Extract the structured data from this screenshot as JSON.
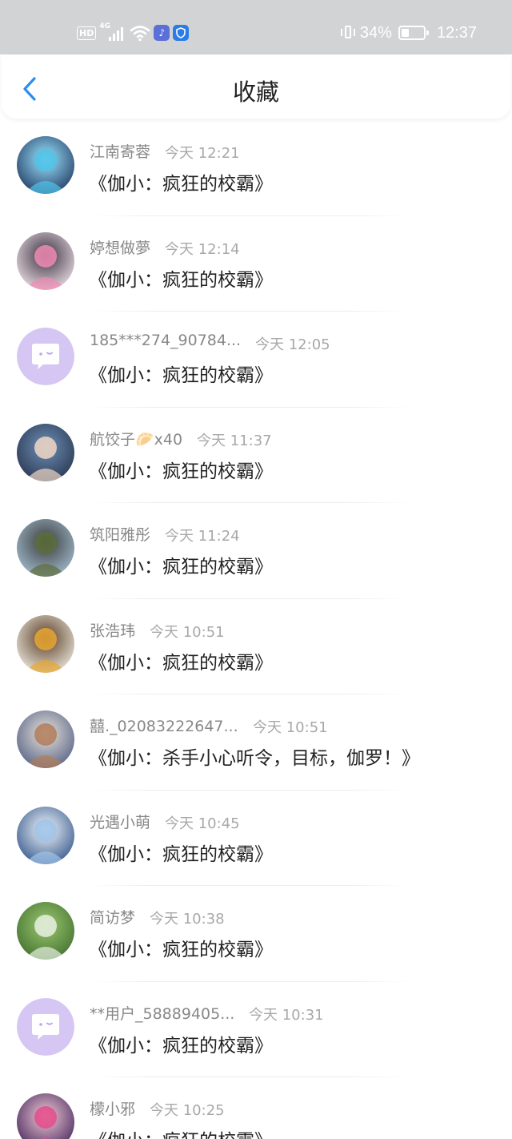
{
  "status_bar": {
    "hd": "HD",
    "network": "4G",
    "battery_percent": "34%",
    "battery_level": 0.34,
    "time": "12:37"
  },
  "nav": {
    "title": "收藏",
    "back_icon": "chevron-left-icon"
  },
  "colors": {
    "accent": "#2a8ef0",
    "status_bar_bg": "#d2d3d5",
    "default_avatar": "#d6c6f3"
  },
  "items": [
    {
      "username": "江南寄蓉",
      "time": "今天 12:21",
      "title": "《伽小：疯狂的校霸》",
      "avatar": "photo-avatar"
    },
    {
      "username": "婷想做夢",
      "time": "今天 12:14",
      "title": "《伽小：疯狂的校霸》",
      "avatar": "photo-avatar"
    },
    {
      "username": "185***274_90784...",
      "time": "今天 12:05",
      "title": "《伽小：疯狂的校霸》",
      "avatar": "default-chat-avatar"
    },
    {
      "username": "航饺子🥟x40",
      "time": "今天 11:37",
      "title": "《伽小：疯狂的校霸》",
      "avatar": "photo-avatar"
    },
    {
      "username": "筑阳雅彤",
      "time": "今天 11:24",
      "title": "《伽小：疯狂的校霸》",
      "avatar": "photo-avatar"
    },
    {
      "username": "张浩玮",
      "time": "今天 10:51",
      "title": "《伽小：疯狂的校霸》",
      "avatar": "photo-avatar"
    },
    {
      "username": "囍._02083222647...",
      "time": "今天 10:51",
      "title": "《伽小：杀手小心听令，目标，伽罗！》",
      "avatar": "photo-avatar"
    },
    {
      "username": "光遇小萌",
      "time": "今天 10:45",
      "title": "《伽小：疯狂的校霸》",
      "avatar": "photo-avatar"
    },
    {
      "username": "简访梦",
      "time": "今天 10:38",
      "title": "《伽小：疯狂的校霸》",
      "avatar": "photo-avatar"
    },
    {
      "username": "**用户_58889405...",
      "time": "今天 10:31",
      "title": "《伽小：疯狂的校霸》",
      "avatar": "default-chat-avatar"
    },
    {
      "username": "檬小邪",
      "time": "今天 10:25",
      "title": "《伽小：疯狂的校霸》",
      "avatar": "photo-avatar"
    }
  ]
}
